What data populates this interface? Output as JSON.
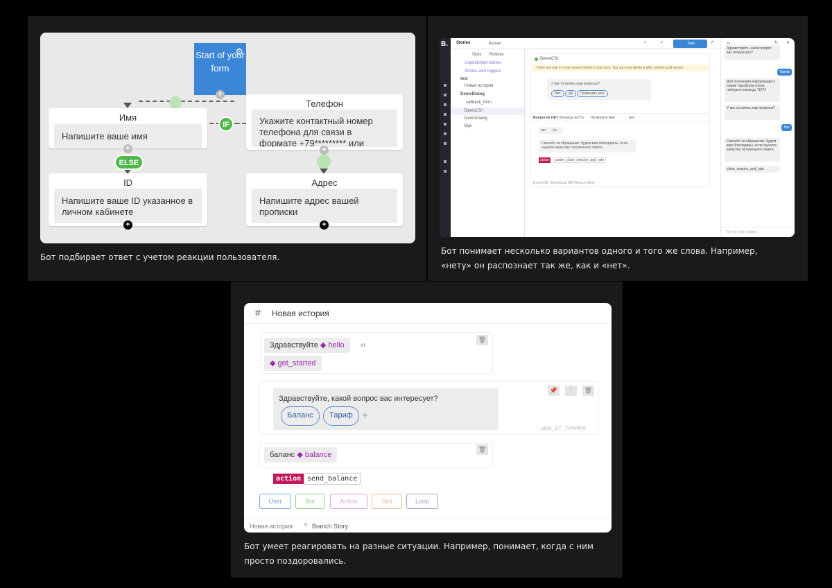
{
  "panel1": {
    "start": "Start of your form",
    "name_title": "Имя",
    "name_msg": "Напишите ваше имя",
    "phone_title": "Телефон",
    "phone_msg": "Укажите контактный номер телефона для связи в формате +79********* или",
    "if_label": "IF",
    "else_label": "ELSE",
    "id_title": "ID",
    "id_msg": "Напишите ваше ID указанное в личном кабинете",
    "addr_title": "Адрес",
    "addr_msg": "Напишите адрес вашей прописки",
    "caption": "Бот подбирает ответ с учетом реакции пользователя.",
    "colors": {
      "start": "#3b86d6",
      "green": "#4fb848"
    }
  },
  "panel2": {
    "logo": "B.",
    "stories_label": "Stories",
    "lang": "Russian",
    "tab_slots": "Slots",
    "tab_policies": "Policies",
    "tree": [
      "Unpublished stories",
      "Stories with triggers",
      "test",
      "Новая история",
      "DemoDialog",
      "callback_form",
      "DemoCSI",
      "DemoDialog",
      "Bye"
    ],
    "train_btn": "Train",
    "story_title": "DemoCSI",
    "warning": "There are one or more stories linked to this story. You can only delete it after unlinking all stories.",
    "bot_q": "У вас остались еще вопросы?",
    "btn_net": "Нет",
    "btn_da": "Да",
    "btn_povtor": "Позвонить мне",
    "branch_tabs": [
      "Вопросов НЕТ",
      "Вопросы ЕСТЬ",
      "Позвоните мне",
      "test"
    ],
    "user_net": "нет",
    "intent_no": "no",
    "bot_thanks": "Спасибо за обращение, будем вам благодарны, если оцените качество полученного ответа.",
    "action_label": "action",
    "action_name": "action_close_session_and_rate",
    "footer_left": "DemoCSI › Вопросов НЕТ",
    "footer_branch": "Branch Story",
    "chat": {
      "lang": "ru",
      "msgs": [
        {
          "side": "bot",
          "text": "Здравствуйте, какой вопрос вас интересует?"
        },
        {
          "side": "user",
          "text": "Тариф"
        },
        {
          "side": "bot",
          "text": "Для получения информации о своем тарифном плане, наберите команду *107#"
        },
        {
          "side": "bot",
          "text": "У вас остались еще вопросы?"
        },
        {
          "side": "user",
          "text": "Нет"
        },
        {
          "side": "bot",
          "text": "Спасибо за обращение, будем вам благодарны, если оцените качество полученного ответа."
        },
        {
          "side": "bot",
          "text": "close_session_and_rate"
        }
      ],
      "placeholder": "Try out your chatbot..."
    },
    "caption": "Бот понимает несколько вариантов одного и того же слова. Например, «нету» он распознает так же, как и «нет»."
  },
  "panel3": {
    "header": "Новая история",
    "greet_text": "Здравствуйте",
    "greet_tag": "hello",
    "or_label": "or",
    "started_tag": "get_started",
    "bot_msg": "Здравствуйте, какой вопрос вас интересует?",
    "btn_balance": "Баланс",
    "btn_tariff": "Тариф",
    "utter_id": "utter_ZT_YiHvWw",
    "balance_text": "баланс",
    "balance_tag": "balance",
    "action_label": "action",
    "action_name": "send_balance",
    "add_buttons": [
      {
        "label": "User",
        "color": "#7ba0dc"
      },
      {
        "label": "Bot",
        "color": "#8fcf8c"
      },
      {
        "label": "Action",
        "color": "#e0a3e2"
      },
      {
        "label": "Slot",
        "color": "#eabb8f"
      },
      {
        "label": "Loop",
        "color": "#9aa0c8"
      }
    ],
    "footer_story": "Новая история",
    "footer_branch": "Branch Story",
    "caption": "Бот умеет реагировать на разные ситуации. Например, понимает, когда с ним просто поздоровались."
  }
}
